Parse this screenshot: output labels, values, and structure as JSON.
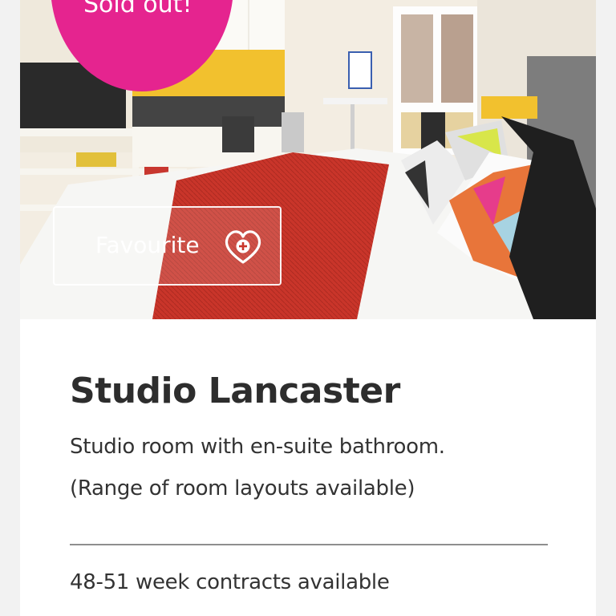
{
  "listing": {
    "badge_text": "Sold out!",
    "favourite_label": "Favourite",
    "title": "Studio Lancaster",
    "description_line1": "Studio room with en-suite bathroom.",
    "description_line2": "(Range of room layouts available)",
    "contracts_text": "48-51 week contracts available"
  },
  "icons": {
    "favourite": "heart-plus-icon"
  },
  "colors": {
    "badge": "#e5248f",
    "text": "#2d2d2d",
    "divider": "#8e8e8e"
  }
}
